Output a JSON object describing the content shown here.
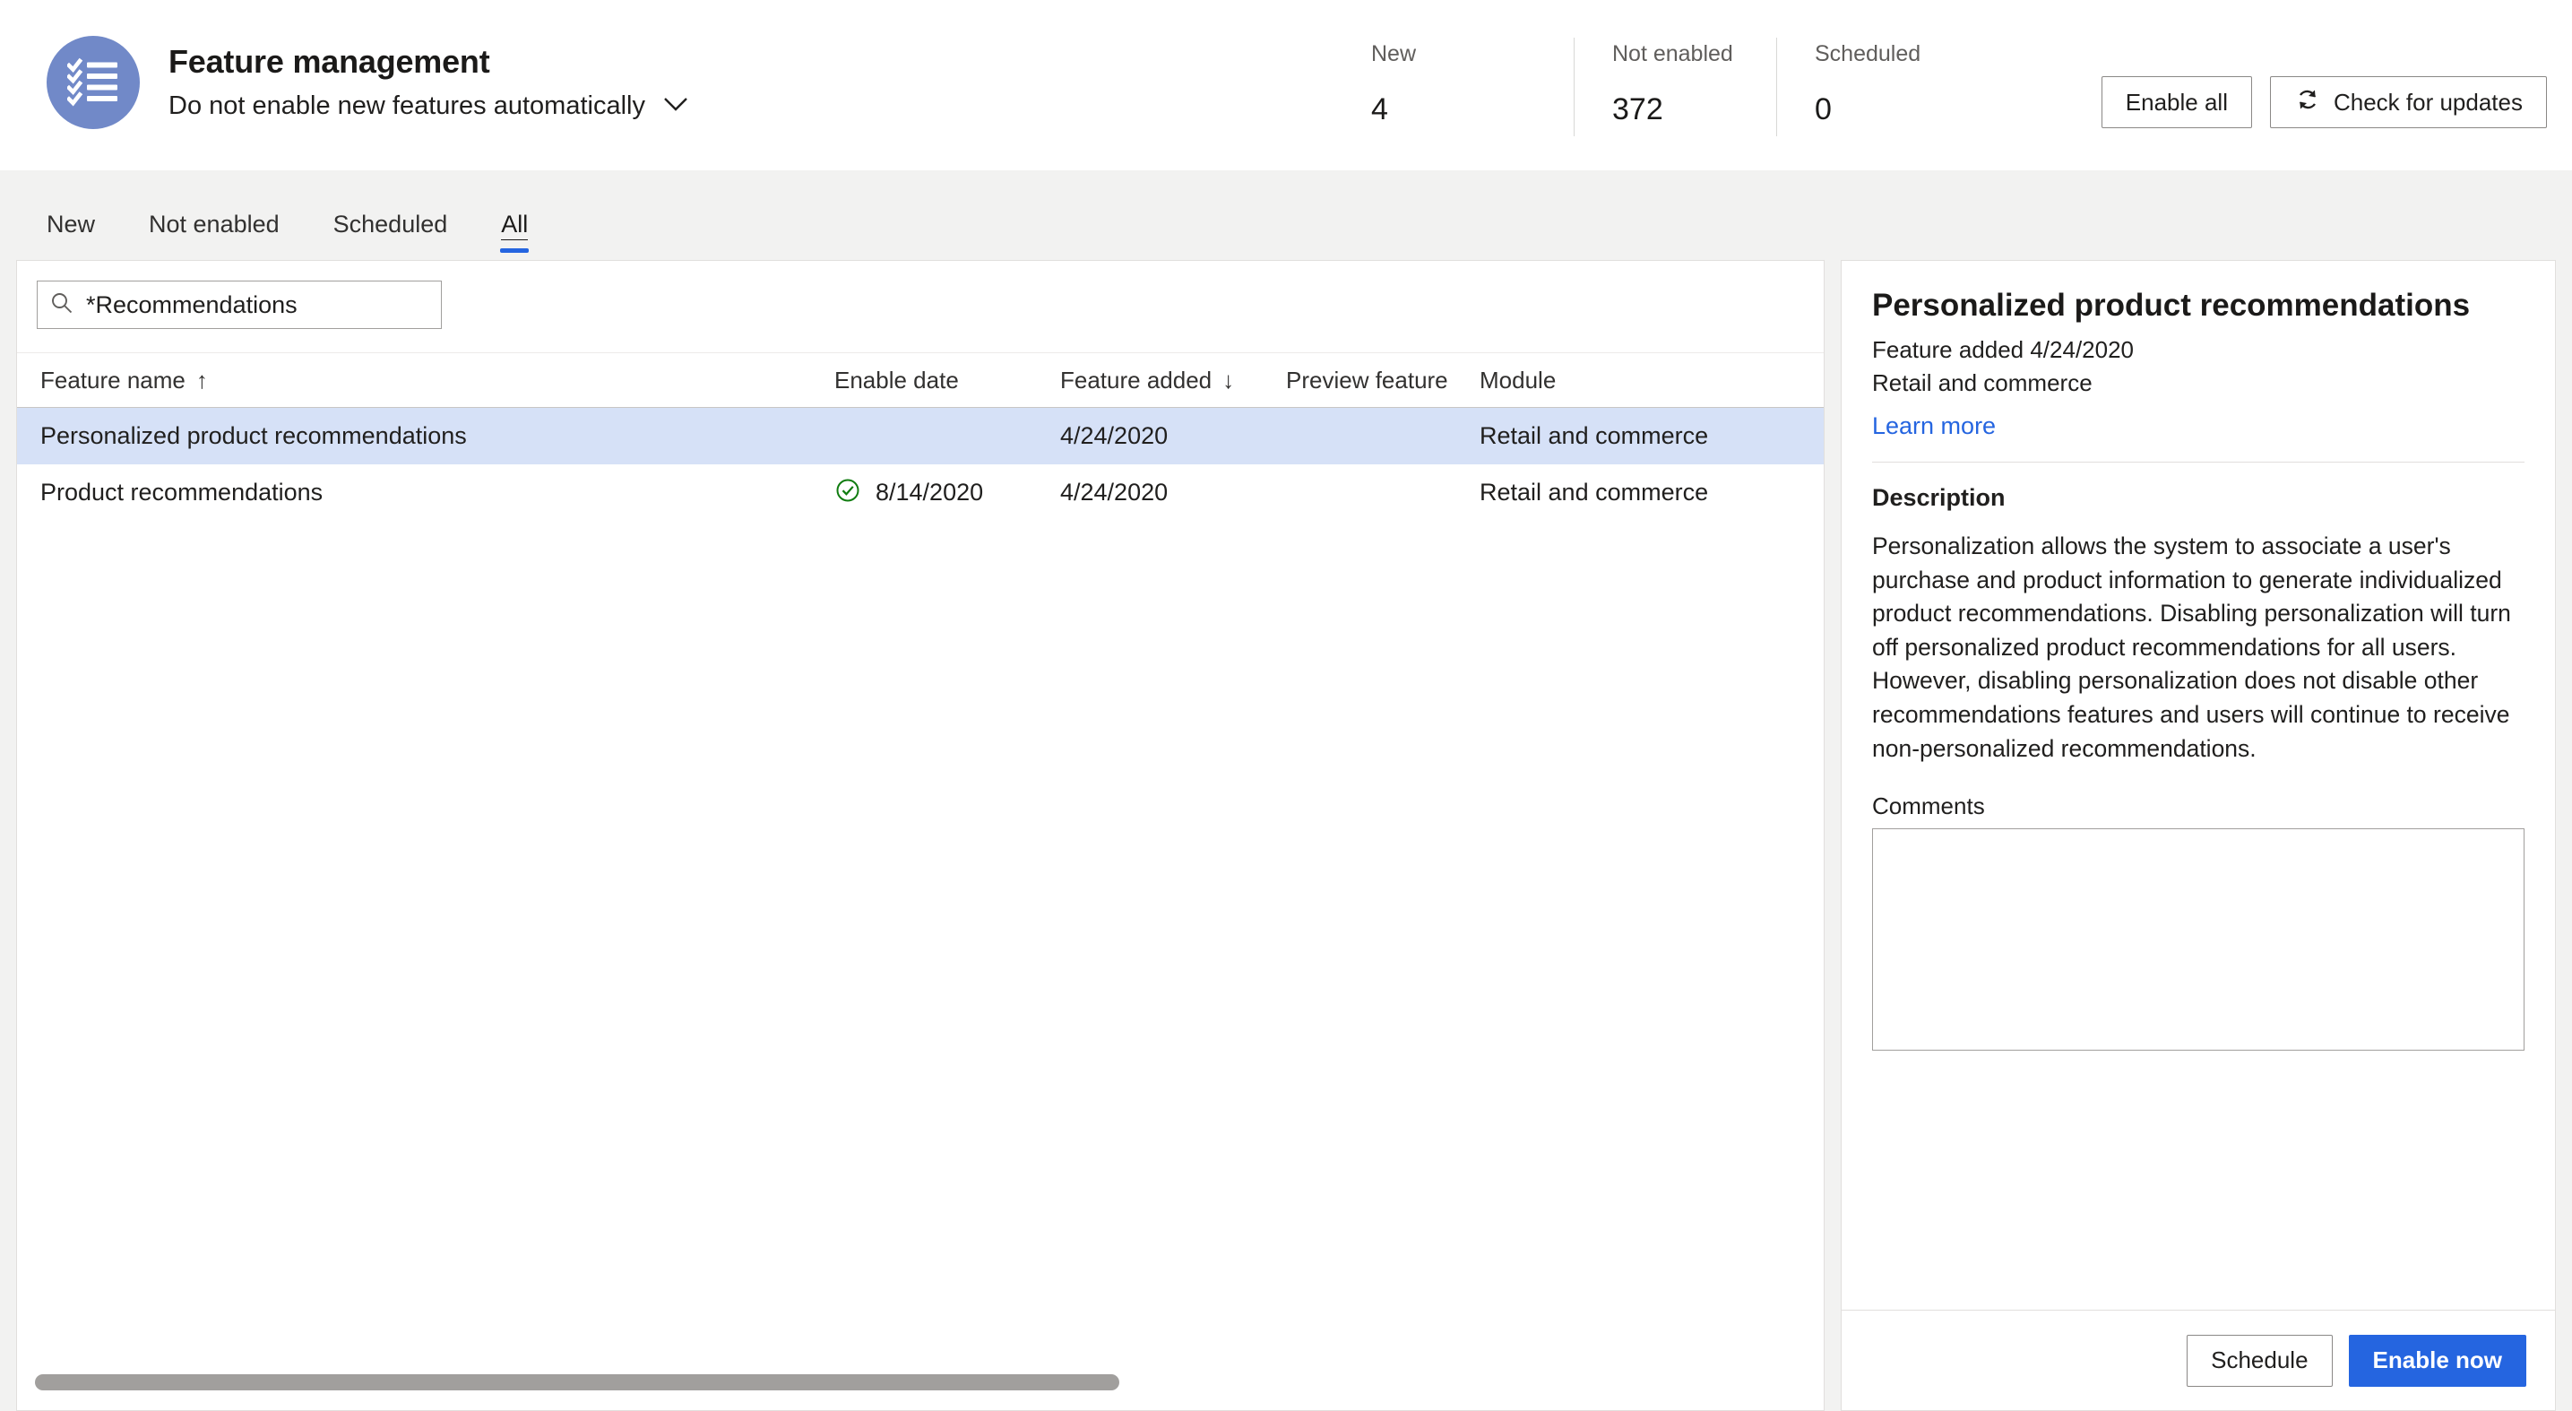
{
  "header": {
    "title": "Feature management",
    "subtitle": "Do not enable new features automatically",
    "icon": "checklist-icon",
    "chevron": "chevron-down-icon",
    "stats": [
      {
        "label": "New",
        "value": "4"
      },
      {
        "label": "Not enabled",
        "value": "372"
      },
      {
        "label": "Scheduled",
        "value": "0"
      }
    ],
    "actions": {
      "enable_all": "Enable all",
      "check_updates": "Check for updates",
      "refresh_icon": "refresh-icon"
    },
    "accent": "#2565e0",
    "icon_bg": "#7189c8"
  },
  "tabs": [
    {
      "label": "New",
      "active": false
    },
    {
      "label": "Not enabled",
      "active": false
    },
    {
      "label": "Scheduled",
      "active": false
    },
    {
      "label": "All",
      "active": true
    }
  ],
  "list": {
    "search": {
      "value": "*Recommendations",
      "placeholder": "",
      "icon": "search-icon"
    },
    "columns": [
      {
        "label": "Feature name",
        "sort": "↑"
      },
      {
        "label": "Enable date",
        "sort": ""
      },
      {
        "label": "Feature added",
        "sort": "↓"
      },
      {
        "label": "Preview feature",
        "sort": ""
      },
      {
        "label": "Module",
        "sort": ""
      }
    ],
    "rows": [
      {
        "feature_name": "Personalized product recommendations",
        "enabled_icon": "",
        "enable_date": "",
        "feature_added": "4/24/2020",
        "preview_feature": "",
        "module": "Retail and commerce",
        "selected": true
      },
      {
        "feature_name": "Product recommendations",
        "enabled_icon": "check-circle-icon",
        "enable_date": "8/14/2020",
        "feature_added": "4/24/2020",
        "preview_feature": "",
        "module": "Retail and commerce",
        "selected": false
      }
    ]
  },
  "detail": {
    "title": "Personalized product recommendations",
    "added_line": "Feature added 4/24/2020",
    "module_line": "Retail and commerce",
    "learn_more": "Learn more",
    "description_label": "Description",
    "description": "Personalization allows the system to associate a user's purchase and product information to generate individualized product recommendations. Disabling personalization will turn off personalized product recommendations for all users. However, disabling personalization does not disable other recommendations features and users will continue to receive non-personalized recommendations.",
    "comments_label": "Comments",
    "comments_value": "",
    "footer": {
      "schedule": "Schedule",
      "enable_now": "Enable now"
    }
  }
}
